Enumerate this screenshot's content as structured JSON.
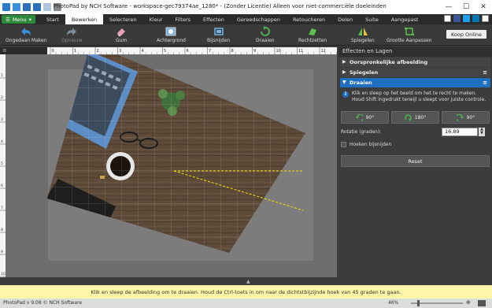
{
  "window": {
    "title": "PhotoPad by NCH Software - workspace-gec79374ae_1280* - (Zonder Licentie) Alleen voor niet-commerciële doeleinden",
    "min": "—",
    "max": "☐",
    "close": "✕"
  },
  "menu": {
    "button": "Menu",
    "tabs": [
      "Start",
      "Bewerken",
      "Selecteren",
      "Kleur",
      "Filters",
      "Effecten",
      "Gereedschappen",
      "Retoucheren",
      "Delen",
      "Suite",
      "Aangepast"
    ],
    "active": "Bewerken"
  },
  "toolbar": {
    "items": [
      {
        "label": "Ongedaan Maken",
        "icon": "undo-icon",
        "disabled": false
      },
      {
        "label": "Opnieuw",
        "icon": "redo-icon",
        "disabled": true
      },
      {
        "label": "Gum",
        "icon": "eraser-icon",
        "disabled": false
      },
      {
        "label": "Achtergrond",
        "icon": "background-icon",
        "disabled": false
      },
      {
        "label": "Bijsnijden",
        "icon": "crop-icon",
        "disabled": false
      },
      {
        "label": "Draaien",
        "icon": "rotate-icon",
        "disabled": false
      },
      {
        "label": "Rechtzetten",
        "icon": "straighten-icon",
        "disabled": false
      },
      {
        "label": "Spiegelen",
        "icon": "mirror-icon",
        "disabled": false
      },
      {
        "label": "Grootte Aanpassen",
        "icon": "resize-icon",
        "disabled": false
      }
    ],
    "buy": "Koop Online"
  },
  "ruler": {
    "labels": [
      "0",
      "1",
      "2",
      "3",
      "4",
      "5",
      "6",
      "7",
      "8",
      "9",
      "10",
      "11",
      "12",
      "13"
    ],
    "vlabels": [
      "1",
      "2",
      "3",
      "4",
      "5",
      "6",
      "7",
      "8",
      "9",
      "10"
    ]
  },
  "panel": {
    "title": "Effecten en Lagen",
    "sections": [
      {
        "label": "Oorspronkelijke afbeelding"
      },
      {
        "label": "Spiegelen"
      },
      {
        "label": "Draaien"
      }
    ],
    "info": "Klik en sleep op het beeld om het te recht te maken. Houd Shift ingedrukt terwijl u sleept voor juiste controle.",
    "buttons": [
      {
        "label": "90°",
        "icon": "rotate-left-icon"
      },
      {
        "label": "180°",
        "icon": "rotate-180-icon"
      },
      {
        "label": "90°",
        "icon": "rotate-right-icon"
      }
    ],
    "angle_label": "Rotatie (graden):",
    "angle_value": "16.89",
    "crop_label": "Hoeken bijsnijden",
    "reset": "Reset"
  },
  "hint": "Klik en sleep de afbeelding om te draaien. Houd de Ctrl-toets in om naar de dichtstbijzijnde hoek van 45 graden te gaan.",
  "status": {
    "version": "PhotoPad v 9.08 © NCH Software",
    "zoom": "46%"
  },
  "colors": {
    "accent": "#1e6fbf",
    "menu_green": "#2e8b3a",
    "hint_bg": "#fdf6a8"
  }
}
